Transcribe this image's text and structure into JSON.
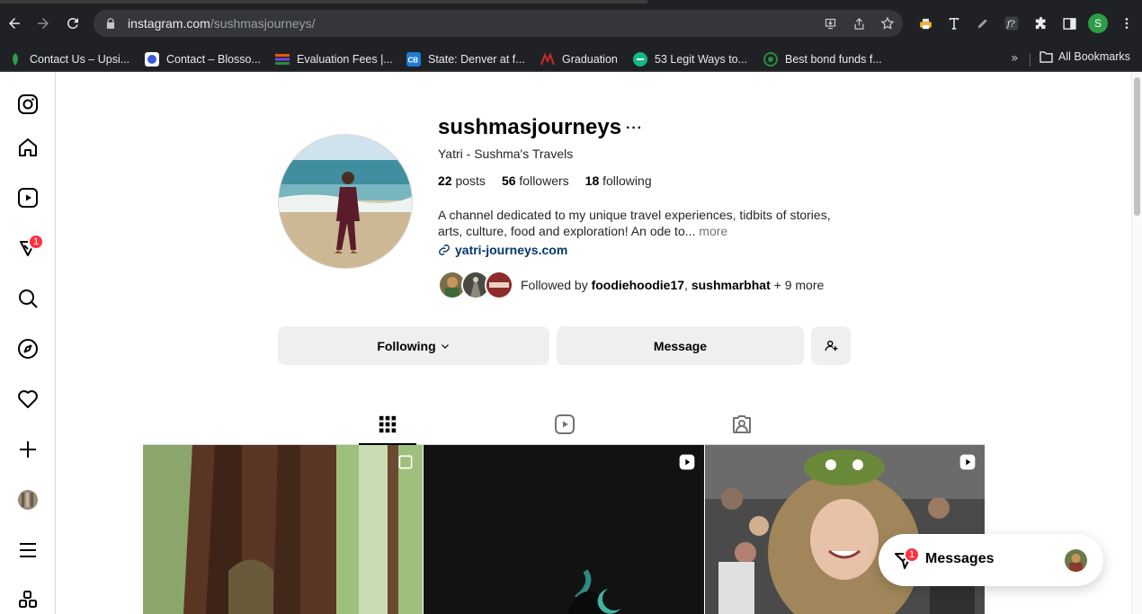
{
  "browser": {
    "url_host": "instagram.com",
    "url_path": "/sushmasjourneys/",
    "profile_initial": "S",
    "bookmarks": [
      {
        "label": "Contact Us – Upsi...",
        "color": "#2e9b47"
      },
      {
        "label": "Contact – Blosso...",
        "color": "#3b5bdb"
      },
      {
        "label": "Evaluation Fees |...",
        "color": "#e8590c"
      },
      {
        "label": "State: Denver at f...",
        "color": "#1c7ed6",
        "abbr": "CB"
      },
      {
        "label": "Graduation",
        "color": "#c92a2a"
      },
      {
        "label": "53 Legit Ways to...",
        "color": "#12b886"
      },
      {
        "label": "Best bond funds f...",
        "color": "#2b8a3e"
      }
    ],
    "all_bookmarks": "All Bookmarks"
  },
  "nav": {
    "notification_count": "1"
  },
  "profile": {
    "username": "sushmasjourneys",
    "more_options": "···",
    "full_name": "Yatri - Sushma's Travels",
    "posts_count": "22",
    "posts_label": "posts",
    "followers_count": "56",
    "followers_label": "followers",
    "following_count": "18",
    "following_label": "following",
    "bio_line1": "A channel dedicated to my unique travel experiences, tidbits of stories,",
    "bio_line2": "arts, culture, food and exploration! An ode to...",
    "bio_more": "more",
    "website": "yatri-journeys.com",
    "followed_prefix": "Followed by",
    "followed_user1": "foodiehoodie17",
    "followed_sep": ",",
    "followed_user2": "sushmarbhat",
    "followed_suffix": "+ 9 more"
  },
  "actions": {
    "following_label": "Following",
    "message_label": "Message"
  },
  "messages": {
    "label": "Messages",
    "count": "1"
  },
  "colors": {
    "badge": "#ff3040",
    "link": "#00376b",
    "button_bg": "#efefef"
  }
}
